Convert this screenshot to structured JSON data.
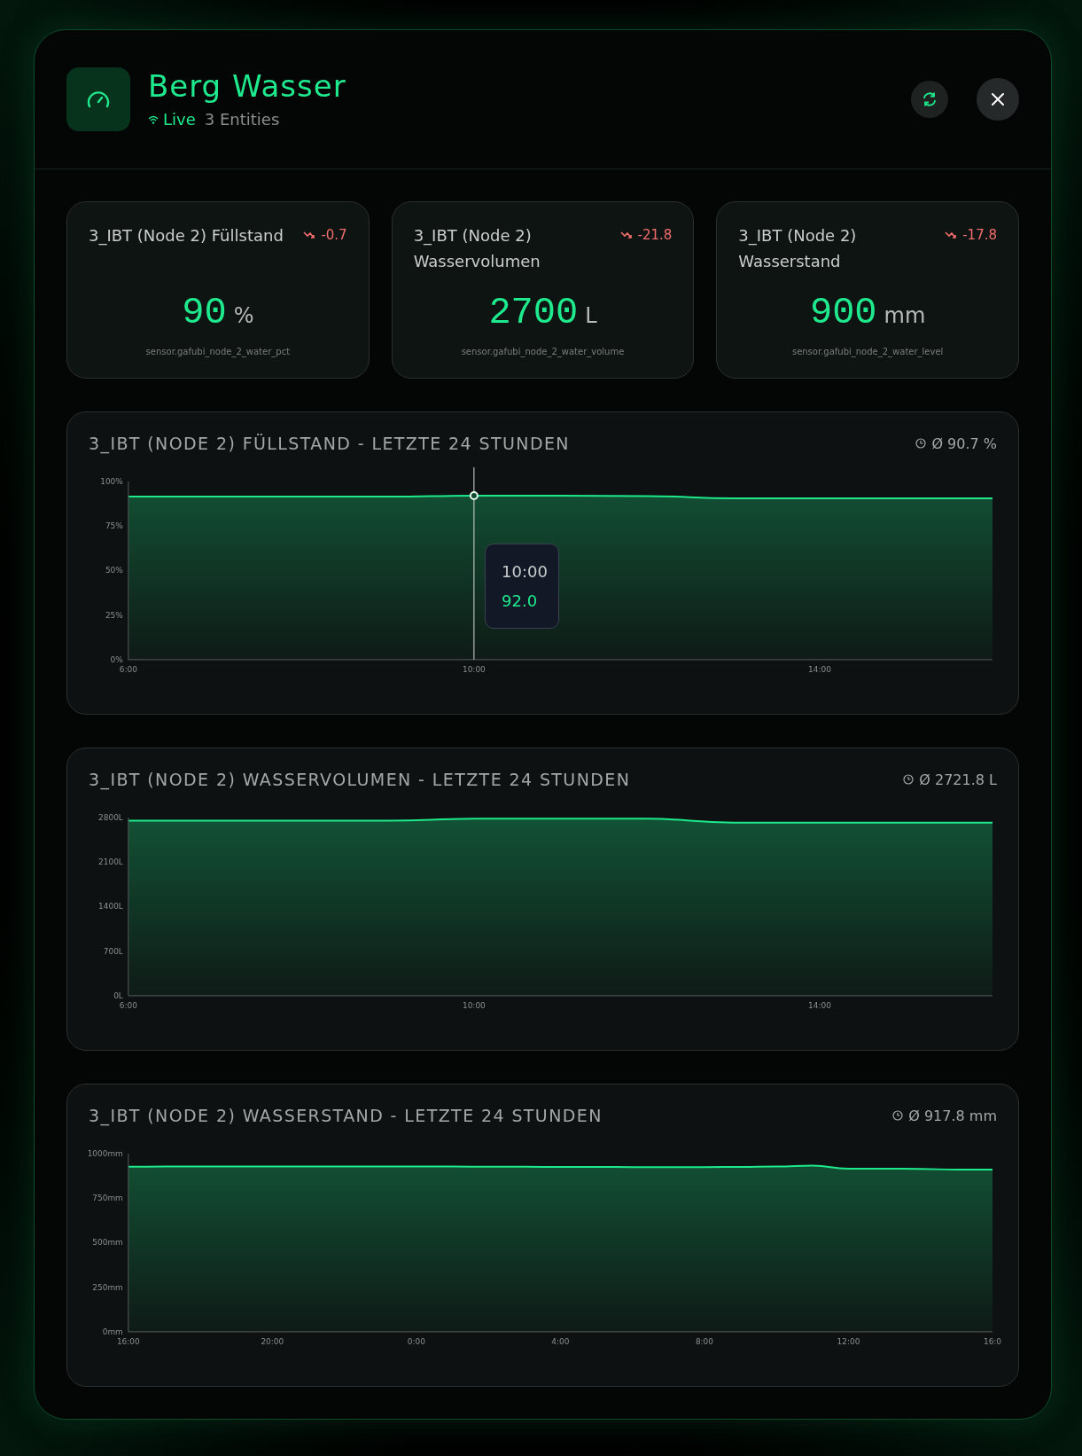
{
  "dialog": {
    "title": "Berg Wasser",
    "status": "Live",
    "entities": "3 Entities"
  },
  "stat_cards": [
    {
      "title": "3_IBT (Node 2) Füllstand",
      "trend": "-0.7",
      "value": "90",
      "unit": "%",
      "entity_id": "sensor.gafubi_node_2_water_pct"
    },
    {
      "title": "3_IBT (Node 2) Wasservolumen",
      "trend": "-21.8",
      "value": "2700",
      "unit": "L",
      "entity_id": "sensor.gafubi_node_2_water_volume"
    },
    {
      "title": "3_IBT (Node 2) Wasserstand",
      "trend": "-17.8",
      "value": "900",
      "unit": "mm",
      "entity_id": "sensor.gafubi_node_2_water_level"
    }
  ],
  "chart_cards": [
    {
      "title": "3_IBT (NODE 2) FÜLLSTAND - LETZTE 24 STUNDEN",
      "average": "Ø 90.7 %",
      "tooltip": {
        "time": "10:00",
        "value": "92.0"
      },
      "chart_data": {
        "type": "area",
        "x": [
          6,
          7,
          8,
          9,
          10,
          11,
          12,
          13,
          14,
          15,
          16
        ],
        "series": [
          {
            "color": "#1de98b",
            "values": [
              91.5,
              91.5,
              91.5,
              91.5,
              92,
              92,
              91.8,
              90.5,
              90.5,
              90.5,
              90.5
            ]
          }
        ],
        "xlim": [
          6,
          16
        ],
        "ylim": [
          0,
          100
        ],
        "xticks": [
          {
            "value": 6,
            "label": "6:00"
          },
          {
            "value": 10,
            "label": "10:00"
          },
          {
            "value": 14,
            "label": "14:00"
          }
        ],
        "yticks": [
          {
            "value": 0,
            "label": "0%"
          },
          {
            "value": 25,
            "label": "25%"
          },
          {
            "value": 50,
            "label": "50%"
          },
          {
            "value": 75,
            "label": "75%"
          },
          {
            "value": 100,
            "label": "100%"
          }
        ]
      }
    },
    {
      "title": "3_IBT (NODE 2) WASSERVOLUMEN - LETZTE 24 STUNDEN",
      "average": "Ø 2721.8 L",
      "chart_data": {
        "type": "area",
        "x": [
          6,
          7,
          8,
          9,
          10,
          11,
          12,
          13,
          14,
          15,
          16
        ],
        "series": [
          {
            "color": "#1de98b",
            "values": [
              2750,
              2750,
              2750,
              2750,
              2780,
              2780,
              2780,
              2720,
              2720,
              2720,
              2720
            ]
          }
        ],
        "xlim": [
          6,
          16
        ],
        "ylim": [
          0,
          2800
        ],
        "xticks": [
          {
            "value": 6,
            "label": "6:00"
          },
          {
            "value": 10,
            "label": "10:00"
          },
          {
            "value": 14,
            "label": "14:00"
          }
        ],
        "yticks": [
          {
            "value": 0,
            "label": "0L"
          },
          {
            "value": 700,
            "label": "700L"
          },
          {
            "value": 1400,
            "label": "1400L"
          },
          {
            "value": 2100,
            "label": "2100L"
          },
          {
            "value": 2800,
            "label": "2800L"
          }
        ]
      }
    },
    {
      "title": "3_IBT (NODE 2) WASSERSTAND - LETZTE 24 STUNDEN",
      "average": "Ø 917.8 mm",
      "chart_data": {
        "type": "area",
        "categories": [
          "16:00",
          null,
          null,
          null,
          "20:00",
          null,
          null,
          null,
          "0:00",
          null,
          null,
          null,
          "4:00",
          null,
          null,
          null,
          "8:00",
          null,
          null,
          null,
          "12:00",
          null,
          null,
          null,
          "16:0"
        ],
        "series": [
          {
            "color": "#1de98b",
            "values": [
              926,
              927,
              928,
              928,
              928,
              928,
              928,
              928,
              927,
              927,
              926,
              926,
              925,
              925,
              924,
              924,
              924,
              925,
              927,
              932,
              915,
              915,
              914,
              910,
              910
            ]
          }
        ],
        "ylim": [
          0,
          1000
        ],
        "yticks": [
          {
            "value": 0,
            "label": "0mm"
          },
          {
            "value": 250,
            "label": "250mm"
          },
          {
            "value": 500,
            "label": "500mm"
          },
          {
            "value": 750,
            "label": "750mm"
          },
          {
            "value": 1000,
            "label": "1000mm"
          }
        ]
      }
    }
  ]
}
